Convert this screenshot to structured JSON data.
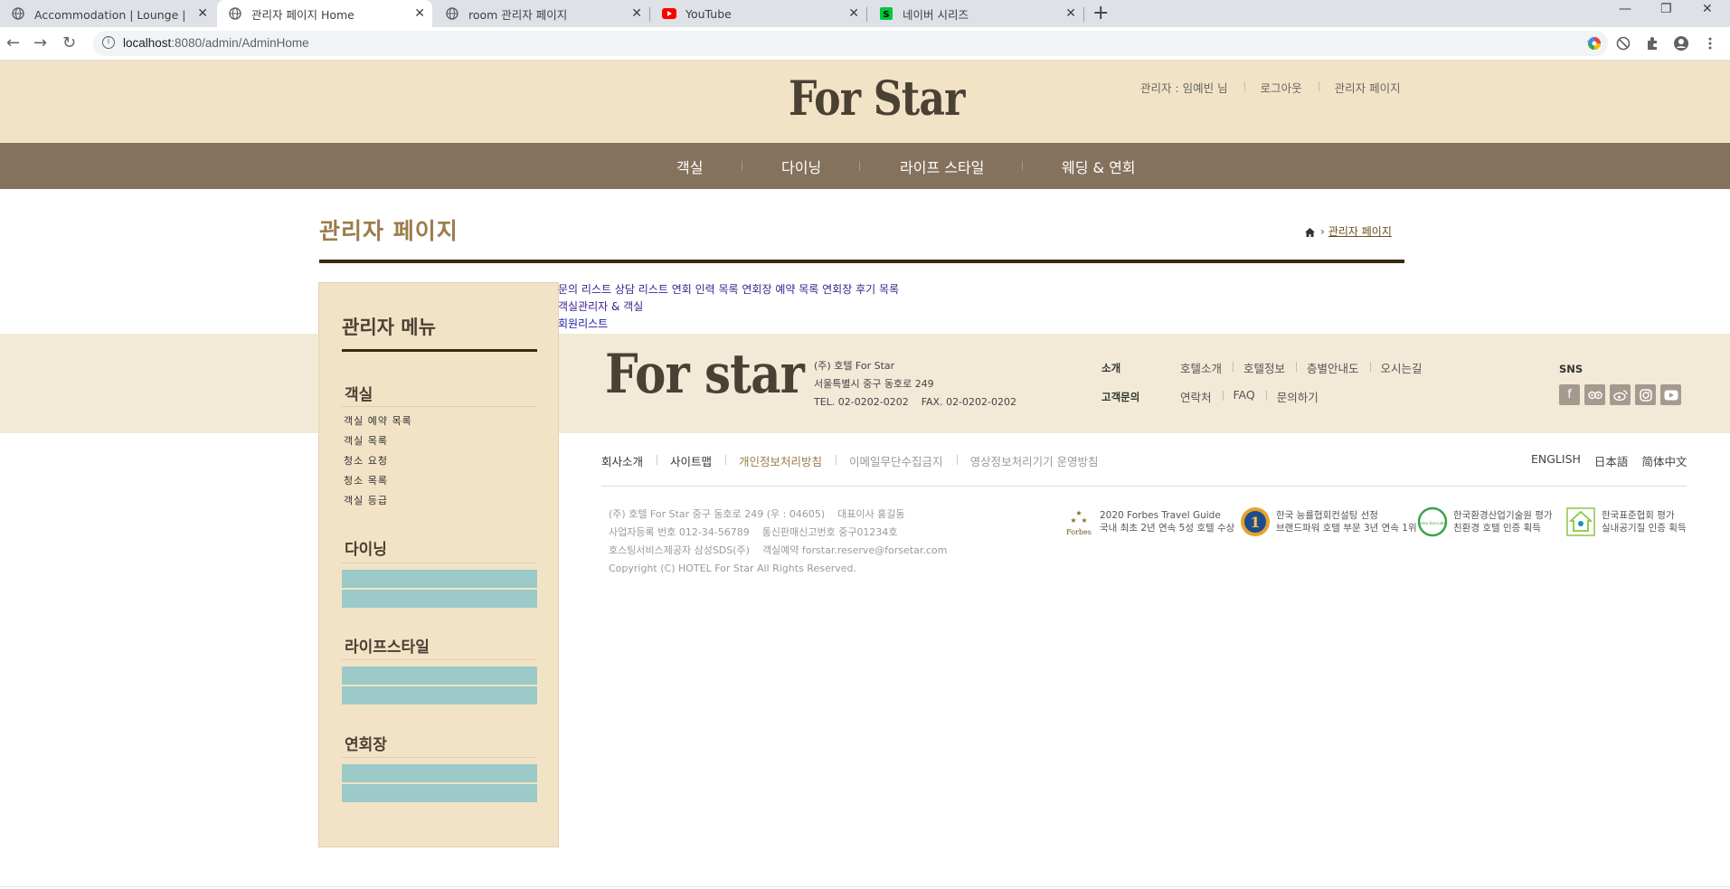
{
  "browser": {
    "tabs": [
      {
        "title": "Accommodation | Lounge | 서울",
        "active": false
      },
      {
        "title": "관리자 페이지 Home",
        "active": true
      },
      {
        "title": "room 관리자 페이지",
        "active": false
      },
      {
        "title": "YouTube",
        "active": false
      },
      {
        "title": "네이버 시리즈",
        "active": false
      }
    ],
    "url_host": "localhost",
    "url_rest": ":8080/admin/AdminHome"
  },
  "header": {
    "logo": "For Star",
    "util_links": [
      "관리자 : 임예빈 님",
      "로그아웃",
      "관리자 페이지"
    ]
  },
  "gnb": [
    "객실",
    "다이닝",
    "라이프 스타일",
    "웨딩 & 연회"
  ],
  "page": {
    "title": "관리자 페이지",
    "breadcrumb_current": "관리자 페이지"
  },
  "sidebar": {
    "title": "관리자 메뉴",
    "sections": [
      {
        "name": "객실",
        "items": [
          "객실 예약 목록",
          "객실 목록",
          "청소 요청",
          "청소 목록",
          "객실 등급"
        ]
      },
      {
        "name": "다이닝",
        "items": []
      },
      {
        "name": "라이프스타일",
        "items": []
      },
      {
        "name": "연회장",
        "items": []
      }
    ]
  },
  "content_links": {
    "row1": [
      "문의 리스트",
      "상담 리스트",
      "연회 인력 목록",
      "연회장 예약 목록",
      "연회장 후기 목록"
    ],
    "row2": "객실관리자 & 객실",
    "row3": "회원리스트"
  },
  "footer": {
    "logo": "For star",
    "info": [
      "(주) 호텔 For Star",
      "서울특별시 중구 동호로 249",
      "TEL. 02-0202-0202    FAX. 02-0202-0202"
    ],
    "menu": [
      {
        "label": "소개",
        "items": [
          "호텔소개",
          "호텔정보",
          "층별안내도",
          "오시는길"
        ]
      },
      {
        "label": "고객문의",
        "items": [
          "연락처",
          "FAQ",
          "문의하기"
        ]
      }
    ],
    "sns_label": "SNS",
    "sns_icons": [
      "facebook-icon",
      "tripadvisor-icon",
      "weibo-icon",
      "instagram-icon",
      "youtube-icon"
    ],
    "links": [
      "회사소개",
      "사이트맵",
      "개인정보처리방침",
      "이메일무단수집금지",
      "영상정보처리기기 운영방침"
    ],
    "languages": [
      "ENGLISH",
      "日本語",
      "简体中文"
    ],
    "address": [
      "(주) 호텔 For Star 중구 동호로 249 (우 : 04605)    대표이사 홍길동",
      "사업자등록 번호 012-34-56789    통신판매신고번호 중구01234호",
      "호스팅서비스제공자 삼성SDS(주)    객실예약 forstar.reserve@forsetar.com",
      "Copyright (C) HOTEL For Star All Rights Reserved."
    ],
    "certs": [
      {
        "line1": "2020 Forbes Travel Guide",
        "line2": "국내 최초 2년 연속 5성 호텔 수상",
        "badge": "Forbes"
      },
      {
        "line1": "한국 능률협회컨설팅 선정",
        "line2": "브랜드파워 호텔 부문 3년 연속 1위",
        "badge": "1"
      },
      {
        "line1": "한국환경산업기술원 평가",
        "line2": "친환경 호텔 인증 획득",
        "badge": "Korea Eco-Label"
      },
      {
        "line1": "한국표준협회 평가",
        "line2": "실내공기질 인증 획득",
        "badge": ""
      }
    ]
  }
}
